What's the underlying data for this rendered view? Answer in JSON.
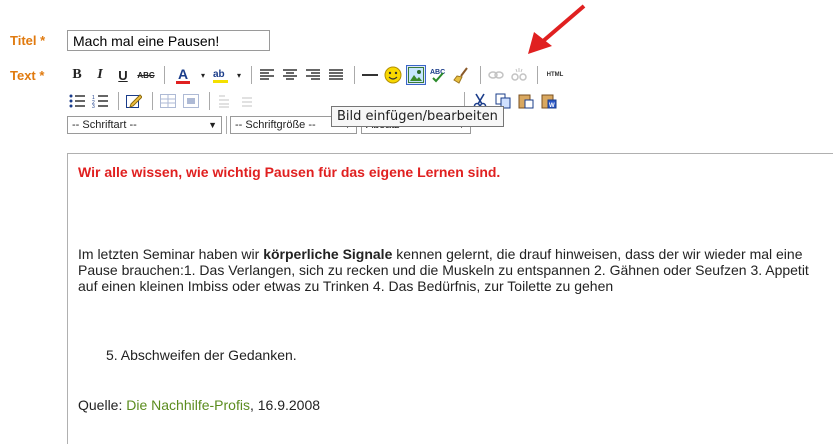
{
  "form": {
    "title_label": "Titel",
    "text_label": "Text",
    "required_mark": "*",
    "title_value": "Mach mal eine Pausen!"
  },
  "toolbar": {
    "bold": "B",
    "italic": "I",
    "underline": "U",
    "strike": "ABC",
    "font_color": "A",
    "html_button": "HTML",
    "font_select": "-- Schriftart --",
    "size_select": "-- Schriftgröße --",
    "format_select": "Absatz",
    "tooltip": "Bild einfügen/bearbeiten"
  },
  "content": {
    "headline": "Wir alle wissen, wie wichtig Pausen für das eigene Lernen sind.",
    "para_before": "Im letzten Seminar haben wir ",
    "para_bold": "körperliche Signale",
    "para_after": " kennen gelernt, die drauf hinweisen, dass der wir wieder mal eine Pause brauchen:1.   Das Verlangen, sich zu recken und die Muskeln zu entspannen 2.   Gähnen oder Seufzen  3.   Appetit auf einen kleinen Imbiss oder etwas zu Trinken  4.   Das Bedürfnis, zur Toilette zu gehen",
    "item5": "5.   Abschweifen der Gedanken.",
    "source_label": "Quelle: ",
    "source_link": "Die Nachhilfe-Profis",
    "source_date": ", 16.9.2008"
  },
  "colors": {
    "label": "#e07a0f",
    "headline": "#e02020",
    "link": "#5b8c1e",
    "arrow": "#e02020"
  }
}
